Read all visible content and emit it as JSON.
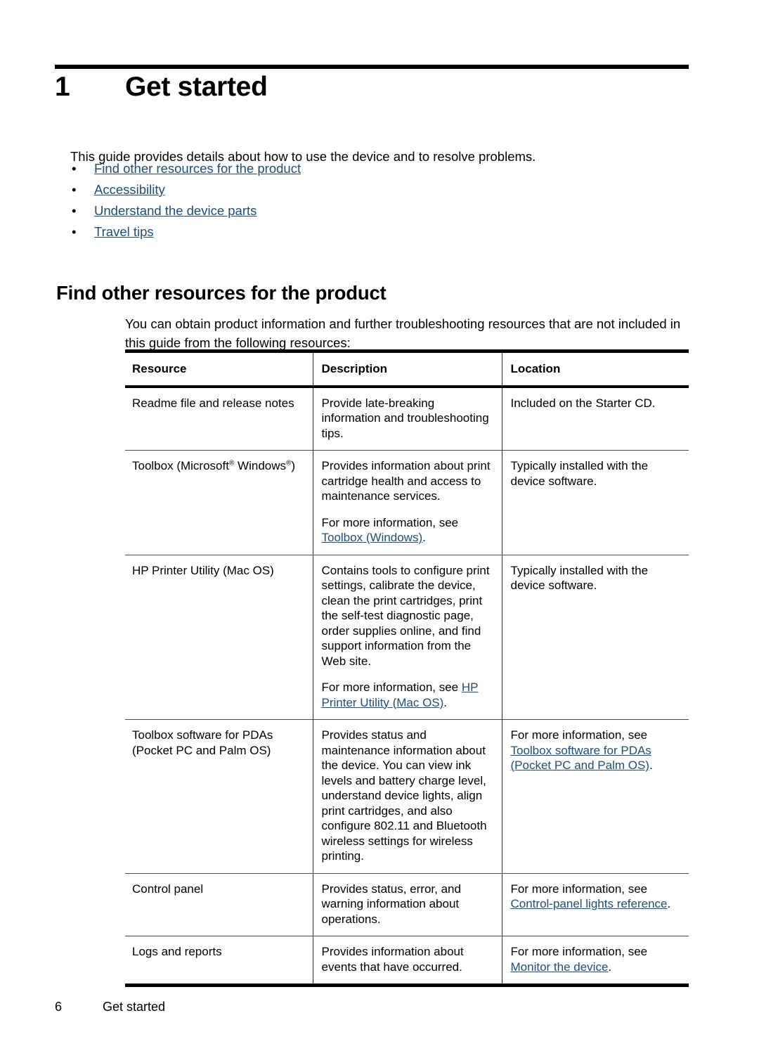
{
  "chapter": {
    "number": "1",
    "title": "Get started",
    "intro": "This guide provides details about how to use the device and to resolve problems.",
    "toc_bullet": "•",
    "toc": [
      "Find other resources for the product",
      "Accessibility",
      "Understand the device parts",
      "Travel tips"
    ]
  },
  "section": {
    "heading": "Find other resources for the product",
    "paragraph": "You can obtain product information and further troubleshooting resources that are not included in this guide from the following resources:"
  },
  "table": {
    "headers": [
      "Resource",
      "Description",
      "Location"
    ],
    "rows": [
      {
        "resource": "Readme file and release notes",
        "description_p1": "Provide late-breaking information and troubleshooting tips.",
        "description_p2": "",
        "description_link": "",
        "description_link_suffix": "",
        "location_text": "Included on the Starter CD.",
        "location_link": "",
        "location_link_suffix": ""
      },
      {
        "resource_pre": "Toolbox (Microsoft",
        "resource_mid": " Windows",
        "resource_post": ")",
        "resource_reg": "®",
        "description_p1": "Provides information about print cartridge health and access to maintenance services.",
        "description_p2": "For more information, see ",
        "description_link": "Toolbox (Windows)",
        "description_link_suffix": ".",
        "location_text": "Typically installed with the device software.",
        "location_link": "",
        "location_link_suffix": ""
      },
      {
        "resource": "HP Printer Utility (Mac OS)",
        "description_p1": "Contains tools to configure print settings, calibrate the device, clean the print cartridges, print the self-test diagnostic page, order supplies online, and find support information from the Web site.",
        "description_p2": "For more information, see ",
        "description_link": "HP Printer Utility (Mac OS)",
        "description_link_suffix": ".",
        "location_text": "Typically installed with the device software.",
        "location_link": "",
        "location_link_suffix": ""
      },
      {
        "resource": "Toolbox software for PDAs (Pocket PC and Palm OS)",
        "description_p1": "Provides status and maintenance information about the device. You can view ink levels and battery charge level, understand device lights, align print cartridges, and also configure 802.11 and Bluetooth wireless settings for wireless printing.",
        "description_p2": "",
        "description_link": "",
        "description_link_suffix": "",
        "location_text": "For more information, see ",
        "location_link": "Toolbox software for PDAs (Pocket PC and Palm OS)",
        "location_link_suffix": "."
      },
      {
        "resource": "Control panel",
        "description_p1": "Provides status, error, and warning information about operations.",
        "description_p2": "",
        "description_link": "",
        "description_link_suffix": "",
        "location_text": "For more information, see ",
        "location_link": "Control-panel lights reference",
        "location_link_suffix": "."
      },
      {
        "resource": "Logs and reports",
        "description_p1": "Provides information about events that have occurred.",
        "description_p2": "",
        "description_link": "",
        "description_link_suffix": "",
        "location_text": "For more information, see ",
        "location_link": "Monitor the device",
        "location_link_suffix": "."
      }
    ]
  },
  "footer": {
    "page_number": "6",
    "label": "Get started"
  },
  "colors": {
    "link": "#1f4e79",
    "text": "#000000",
    "rule": "#000000"
  }
}
